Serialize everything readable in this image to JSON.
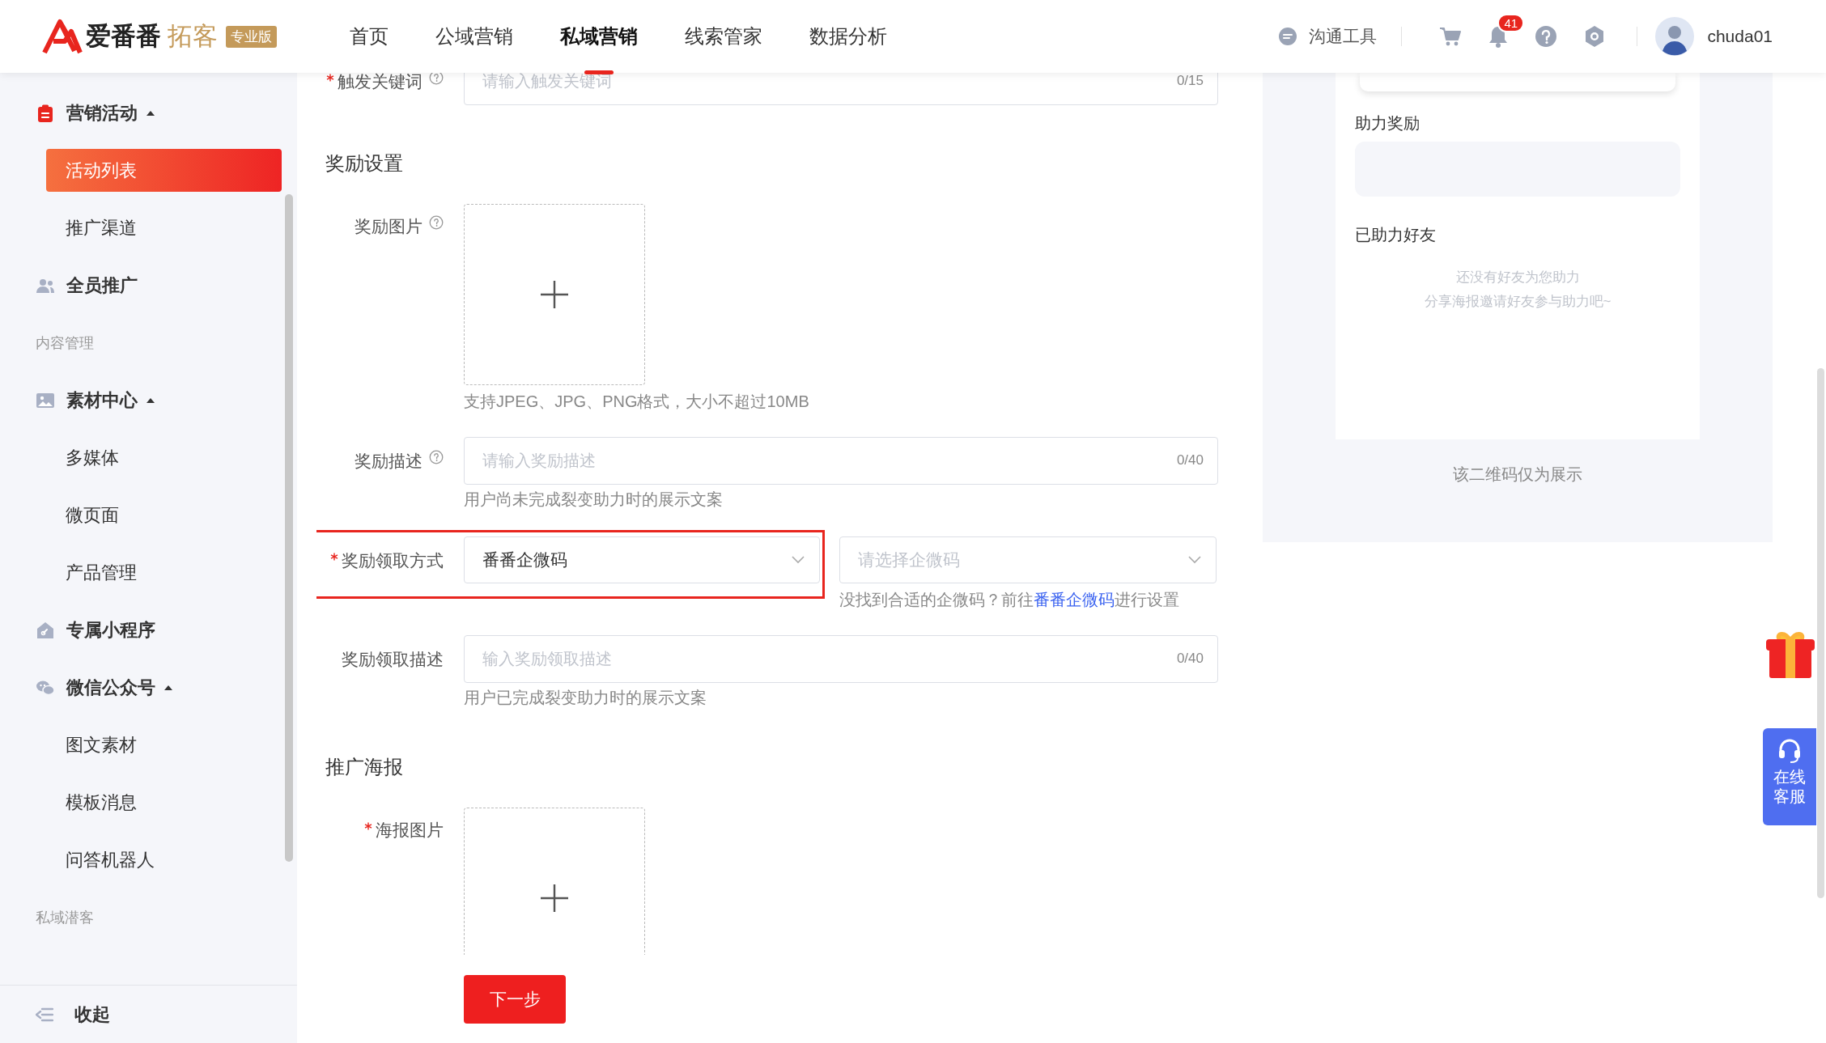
{
  "header": {
    "logo": {
      "brand": "爱番番",
      "product": "拓客",
      "edition": "专业版"
    },
    "nav": [
      {
        "label": "首页",
        "selected": false
      },
      {
        "label": "公域营销",
        "selected": false
      },
      {
        "label": "私域营销",
        "selected": true
      },
      {
        "label": "线索管家",
        "selected": false
      },
      {
        "label": "数据分析",
        "selected": false
      }
    ],
    "chat_label": "沟通工具",
    "notification_count": "41",
    "user_name": "chuda01"
  },
  "sidebar": {
    "items": [
      {
        "kind": "group",
        "label": "营销活动",
        "expanded": true,
        "children": [
          {
            "label": "活动列表",
            "selected": true
          },
          {
            "label": "推广渠道",
            "selected": false
          }
        ]
      },
      {
        "kind": "group",
        "label": "全员推广"
      },
      {
        "kind": "heading",
        "label": "内容管理"
      },
      {
        "kind": "group",
        "label": "素材中心",
        "expanded": true,
        "children": [
          {
            "label": "多媒体",
            "selected": false
          },
          {
            "label": "微页面",
            "selected": false
          },
          {
            "label": "产品管理",
            "selected": false
          }
        ]
      },
      {
        "kind": "group",
        "label": "专属小程序"
      },
      {
        "kind": "group",
        "label": "微信公众号",
        "expanded": true,
        "children": [
          {
            "label": "图文素材",
            "selected": false
          },
          {
            "label": "模板消息",
            "selected": false
          },
          {
            "label": "问答机器人",
            "selected": false
          }
        ]
      },
      {
        "kind": "heading",
        "label": "私域潜客"
      }
    ],
    "collapse_label": "收起"
  },
  "form": {
    "fields": [
      {
        "kind": "input",
        "label": "触发关键词",
        "required": true,
        "help": true,
        "placeholder": "请输入触发关键词",
        "counter": "0/15"
      },
      {
        "kind": "section",
        "title": "奖励设置"
      },
      {
        "kind": "upload",
        "label": "奖励图片",
        "required": false,
        "help": true,
        "hint": "支持JPEG、JPG、PNG格式，大小不超过10MB"
      },
      {
        "kind": "input",
        "label": "奖励描述",
        "required": false,
        "help": true,
        "placeholder": "请输入奖励描述",
        "counter": "0/40",
        "hint": "用户尚未完成裂变助力时的展示文案"
      },
      {
        "kind": "select",
        "label": "奖励领取方式",
        "required": true,
        "help": false,
        "highlighted": true,
        "value": "番番企微码",
        "second_placeholder": "请选择企微码",
        "note": "没找到合适的企微码？前往",
        "note_link": "番番企微码",
        "note_end": "进行设置"
      },
      {
        "kind": "input",
        "label": "奖励领取描述",
        "required": false,
        "help": false,
        "placeholder": "输入奖励领取描述",
        "counter": "0/40",
        "hint": "用户已完成裂变助力时的展示文案"
      },
      {
        "kind": "section",
        "title": "推广海报"
      },
      {
        "kind": "upload",
        "label": "海报图片",
        "required": true,
        "help": false
      }
    ],
    "next_button": "下一步"
  },
  "preview": {
    "reward_title": "助力奖励",
    "friends_title": "已助力好友",
    "empty_lines": [
      "还没有好友为您助力",
      "分享海报邀请好友参与助力吧~"
    ],
    "caption": "该二维码仅为展示"
  },
  "float": {
    "service_label": "在线客服"
  }
}
